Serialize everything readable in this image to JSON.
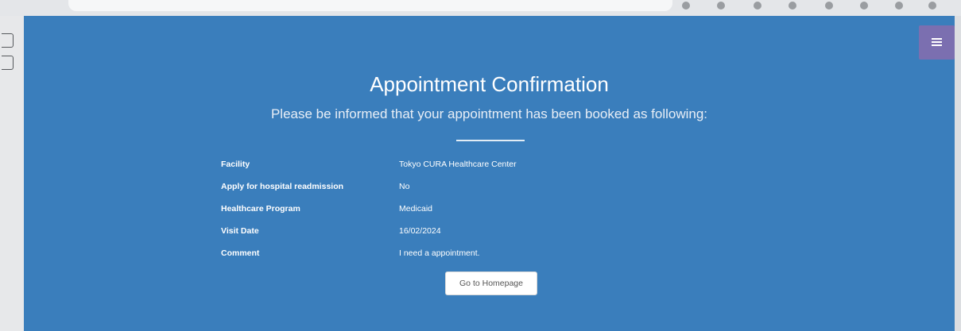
{
  "menu": {
    "icon": "hamburger-icon"
  },
  "page": {
    "title": "Appointment Confirmation",
    "subtitle": "Please be informed that your appointment has been booked as following:"
  },
  "details": [
    {
      "label": "Facility",
      "value": "Tokyo CURA Healthcare Center"
    },
    {
      "label": "Apply for hospital readmission",
      "value": "No"
    },
    {
      "label": "Healthcare Program",
      "value": "Medicaid"
    },
    {
      "label": "Visit Date",
      "value": "16/02/2024"
    },
    {
      "label": "Comment",
      "value": "I need a appointment."
    }
  ],
  "actions": {
    "home_label": "Go to Homepage"
  },
  "colors": {
    "background": "#3a7ebc",
    "menu_button": "#7b6fb0",
    "text": "#ffffff"
  }
}
